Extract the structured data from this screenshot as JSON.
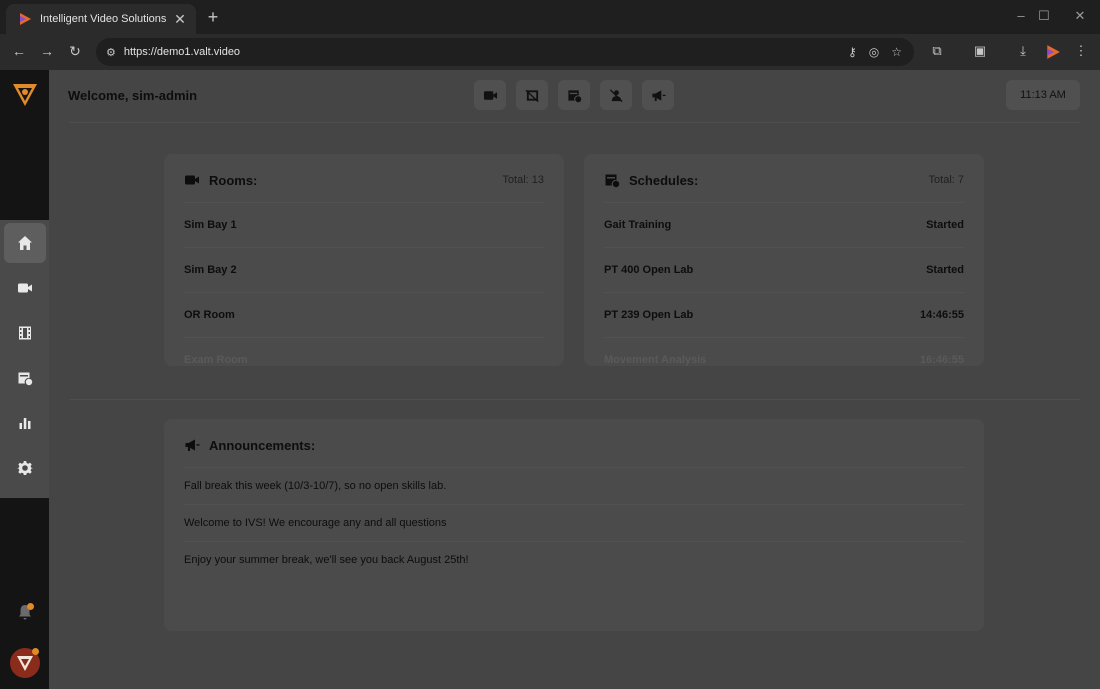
{
  "browser": {
    "tab_title": "Intelligent Video Solutions",
    "url": "https://demo1.valt.video"
  },
  "header": {
    "welcome": "Welcome, sim-admin",
    "time": "11:13 AM"
  },
  "rooms": {
    "title": "Rooms:",
    "total": "Total: 13",
    "items": [
      {
        "name": "Sim Bay 1"
      },
      {
        "name": "Sim Bay 2"
      },
      {
        "name": "OR Room"
      },
      {
        "name": "Exam Room"
      }
    ]
  },
  "schedules": {
    "title": "Schedules:",
    "total": "Total: 7",
    "items": [
      {
        "name": "Gait Training",
        "status": "Started"
      },
      {
        "name": "PT 400 Open Lab",
        "status": "Started"
      },
      {
        "name": "PT 239 Open Lab",
        "status": "14:46:55"
      },
      {
        "name": "Movement Analysis",
        "status": "16:46:55"
      }
    ]
  },
  "announcements": {
    "title": "Announcements:",
    "items": [
      "Fall break this week (10/3-10/7), so no open skills lab.",
      "Welcome to IVS! We encourage any and all questions",
      "Enjoy your summer break, we'll see you back August 25th!"
    ]
  },
  "colors": {
    "brand": "#e08a2a",
    "rail_highlight": "#ffffff"
  },
  "icons": {
    "rail": [
      "home-icon",
      "video-camera-icon",
      "film-icon",
      "schedule-icon",
      "bar-chart-icon",
      "gear-icon"
    ],
    "quick": [
      "video-camera-icon",
      "video-off-icon",
      "schedule-icon",
      "user-off-icon",
      "megaphone-icon"
    ]
  }
}
